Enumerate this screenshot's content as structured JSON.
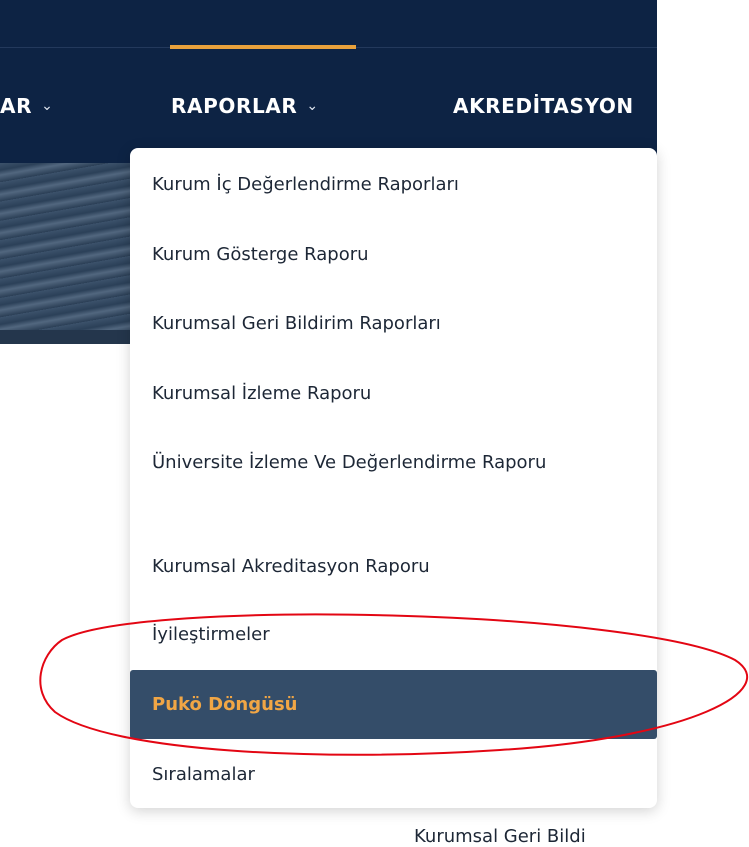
{
  "nav": {
    "items": [
      {
        "label": "AR"
      },
      {
        "label": "RAPORLAR"
      },
      {
        "label": "AKREDİTASYON"
      }
    ],
    "chevron": "⌄"
  },
  "dropdown": {
    "items": [
      {
        "label": "Kurum İç Değerlendirme Raporları"
      },
      {
        "label": "Kurum Gösterge Raporu"
      },
      {
        "label": "Kurumsal Geri Bildirim Raporları"
      },
      {
        "label": "Kurumsal İzleme Raporu"
      },
      {
        "label": "Üniversite İzleme Ve Değerlendirme Raporu"
      },
      {
        "label": "Kurumsal Akreditasyon Raporu"
      },
      {
        "label": "İyileştirmeler"
      },
      {
        "label": "Pukö Döngüsü"
      },
      {
        "label": "Sıralamalar"
      }
    ]
  },
  "footer": {
    "partial_text": "Kurumsal Geri Bildi"
  },
  "colors": {
    "navbar": "#0d2344",
    "accent": "#e8a13c",
    "active_item_bg": "#344d69",
    "active_item_text": "#f1a645",
    "annotation": "#e30613"
  }
}
